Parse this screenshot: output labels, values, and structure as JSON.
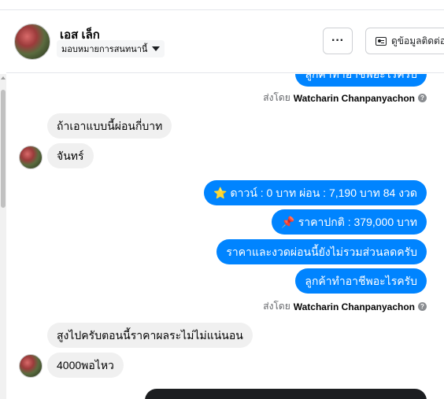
{
  "header": {
    "contact_name": "เอส เล็ก",
    "assign_label": "มอบหมายการสนทนานี้",
    "more_label": "···",
    "contact_info_label": "ดูข้อมูลติดต่อ"
  },
  "chat": {
    "top_partial_message": "ลูกค้าทำอาชีพอะไรครับ",
    "sent_by_prefix": "ส่งโดย",
    "agent_name": "Watcharin Chanpanyachon",
    "help_glyph": "?",
    "group1_incoming": [
      "ถ้าเอาแบบนี้ผ่อนกี่บาท",
      "จันทร์"
    ],
    "group2_outgoing": [
      "ดาวน์ : 0 บาท ผ่อน : 7,190 บาท 84 งวด",
      "ราคาปกติ : 379,000 บาท",
      "ราคาและงวดผ่อนนี้ยังไม่รวมส่วนลดครับ",
      "ลูกค้าทำอาชีพอะไรครับ"
    ],
    "star_emoji": "⭐",
    "pin_emoji": "📌",
    "group3_incoming": [
      "สูงไปครับตอนนี้ราคาผลระไม่ไม่แน่นอน",
      "4000พอไหว"
    ]
  },
  "colors": {
    "outgoing_bubble": "#0084ff",
    "incoming_bubble": "#f0f0f0",
    "dark_bubble": "#1c1e21"
  }
}
